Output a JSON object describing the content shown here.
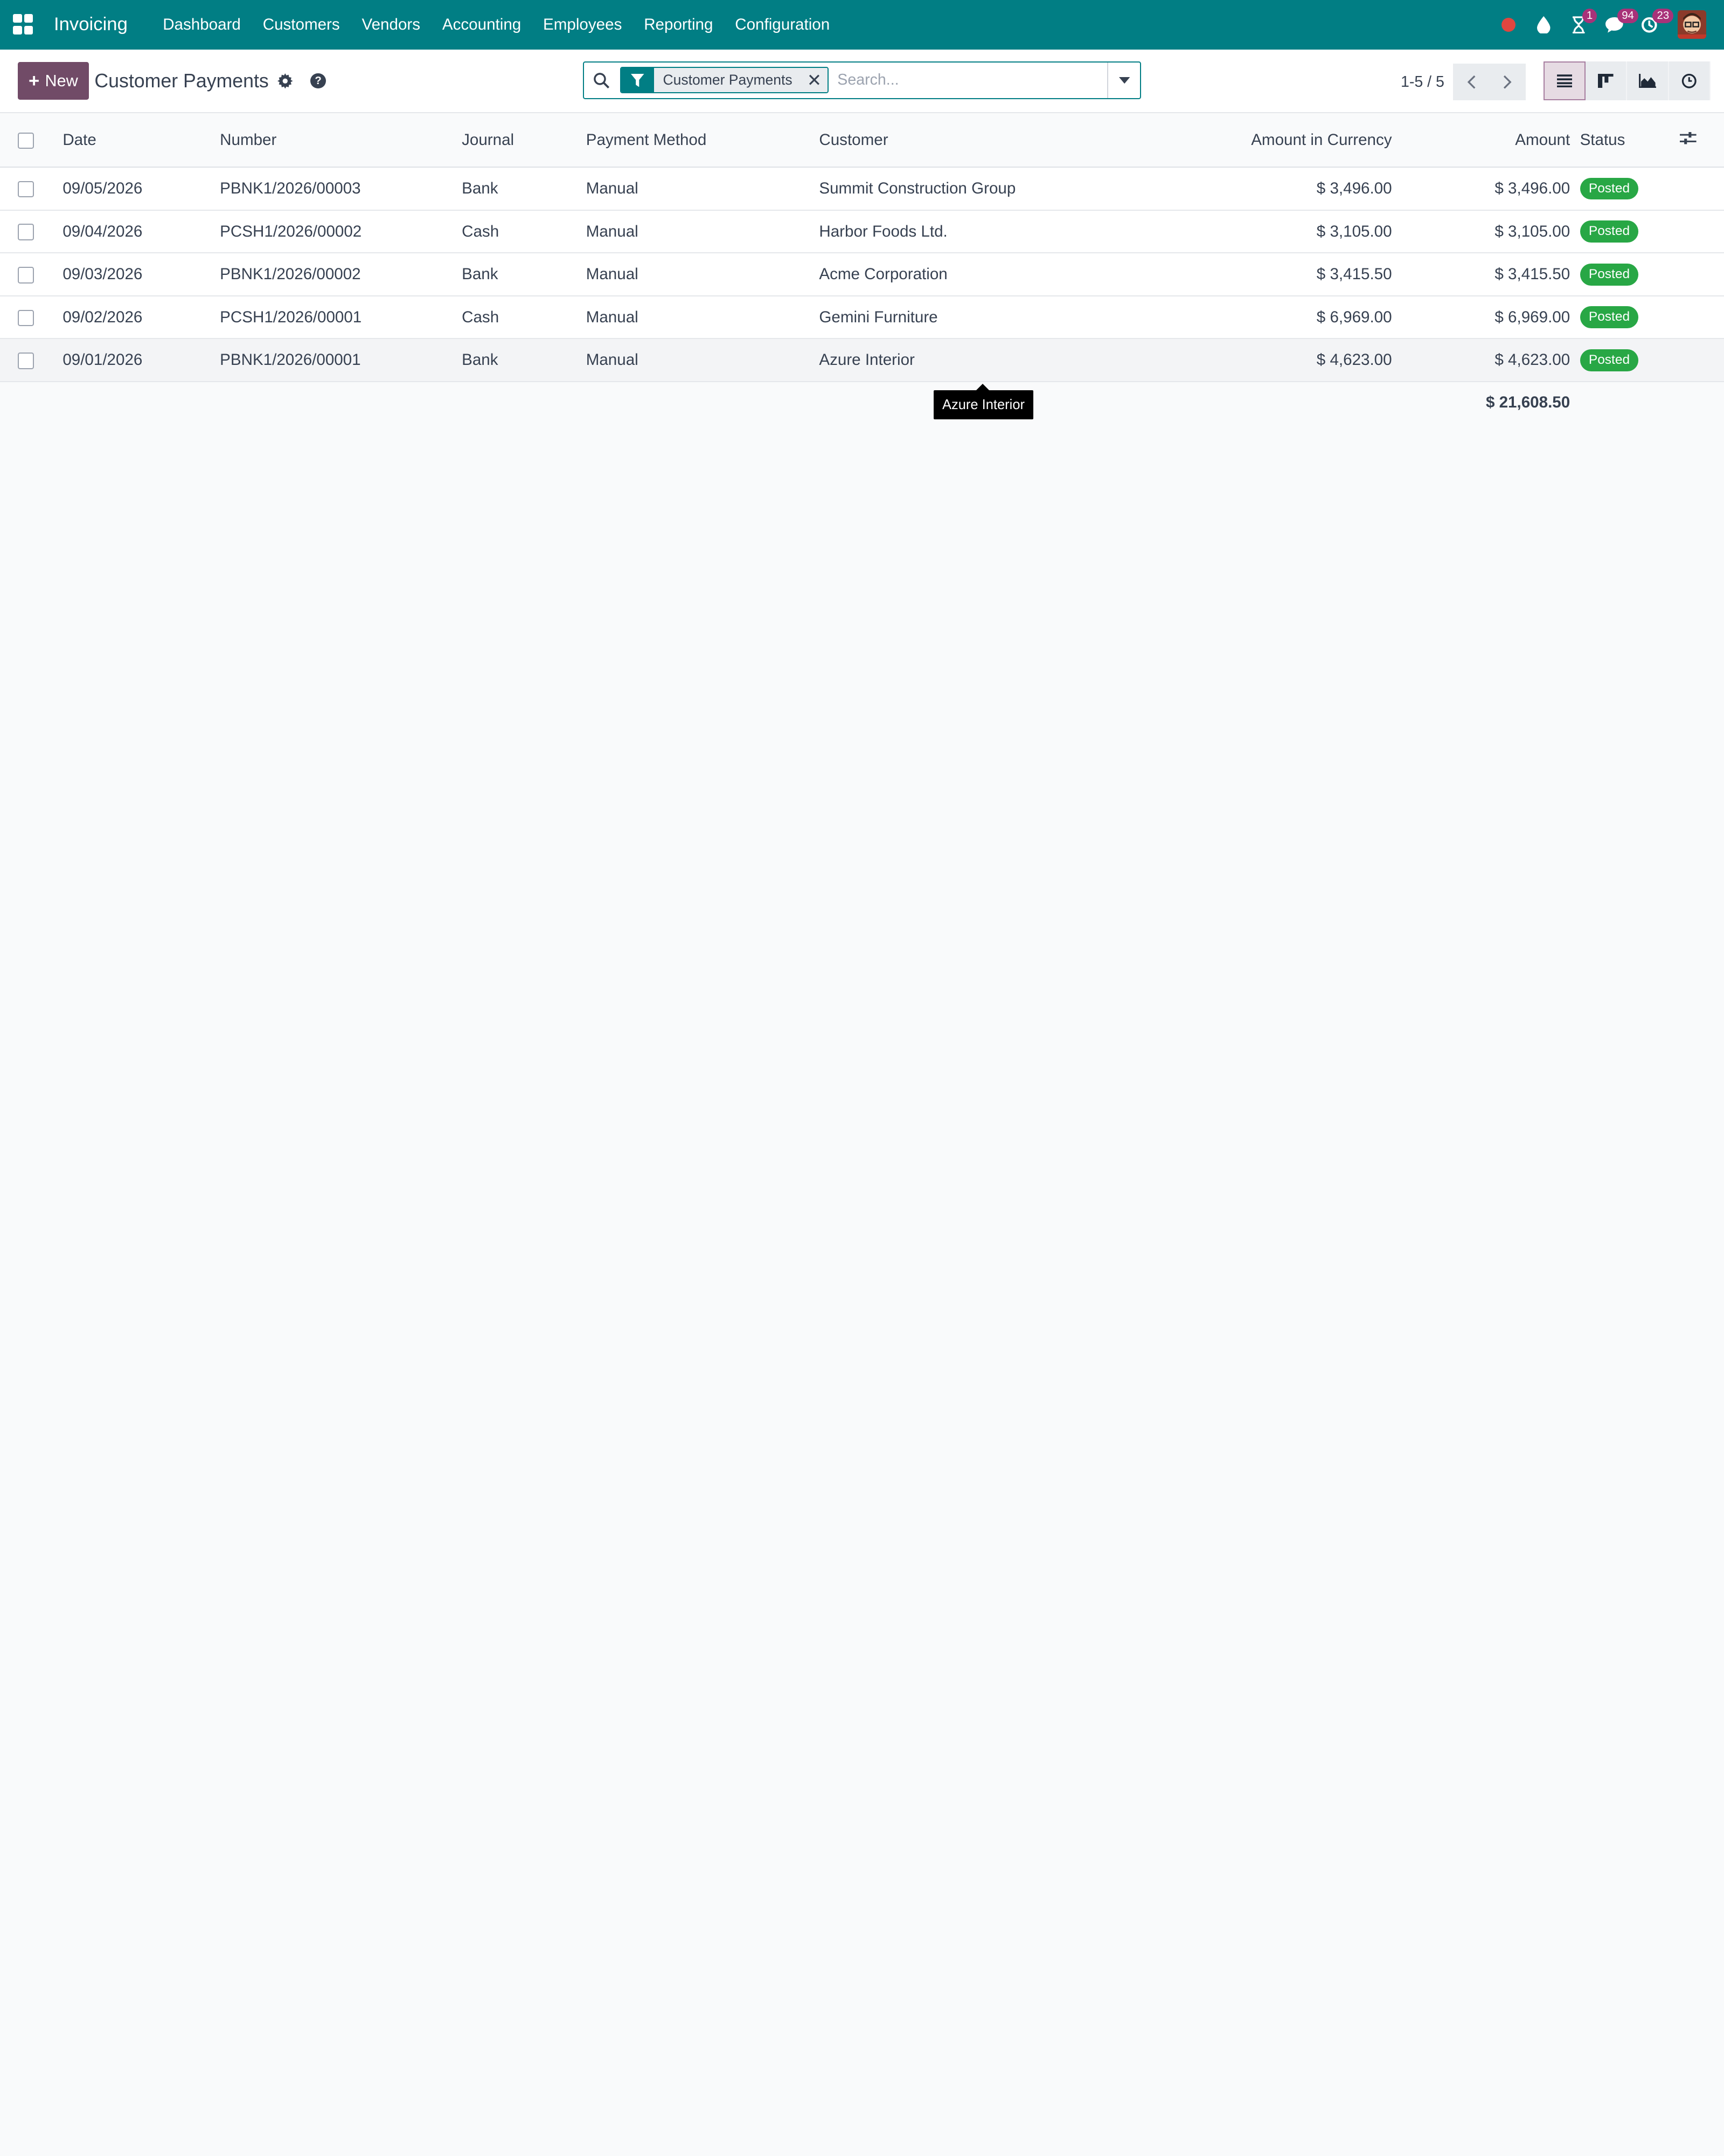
{
  "navbar": {
    "brand": "Invoicing",
    "menu": [
      "Dashboard",
      "Customers",
      "Vendors",
      "Accounting",
      "Employees",
      "Reporting",
      "Configuration"
    ],
    "badges": {
      "activities": "1",
      "messages": "94",
      "updates": "23"
    }
  },
  "control": {
    "new_label": "New",
    "title": "Customer Payments",
    "search_facet": "Customer Payments",
    "search_placeholder": "Search...",
    "pager": "1-5 / 5"
  },
  "table": {
    "columns": {
      "date": "Date",
      "number": "Number",
      "journal": "Journal",
      "payment_method": "Payment Method",
      "customer": "Customer",
      "amount_currency": "Amount in Currency",
      "amount": "Amount",
      "status": "Status"
    },
    "rows": [
      {
        "date": "09/05/2026",
        "number": "PBNK1/2026/00003",
        "journal": "Bank",
        "method": "Manual",
        "customer": "Summit Construction Group",
        "amount_currency": "$ 3,496.00",
        "amount": "$ 3,496.00",
        "status": "Posted"
      },
      {
        "date": "09/04/2026",
        "number": "PCSH1/2026/00002",
        "journal": "Cash",
        "method": "Manual",
        "customer": "Harbor Foods Ltd.",
        "amount_currency": "$ 3,105.00",
        "amount": "$ 3,105.00",
        "status": "Posted"
      },
      {
        "date": "09/03/2026",
        "number": "PBNK1/2026/00002",
        "journal": "Bank",
        "method": "Manual",
        "customer": "Acme Corporation",
        "amount_currency": "$ 3,415.50",
        "amount": "$ 3,415.50",
        "status": "Posted"
      },
      {
        "date": "09/02/2026",
        "number": "PCSH1/2026/00001",
        "journal": "Cash",
        "method": "Manual",
        "customer": "Gemini Furniture",
        "amount_currency": "$ 6,969.00",
        "amount": "$ 6,969.00",
        "status": "Posted"
      },
      {
        "date": "09/01/2026",
        "number": "PBNK1/2026/00001",
        "journal": "Bank",
        "method": "Manual",
        "customer": "Azure Interior",
        "amount_currency": "$ 4,623.00",
        "amount": "$ 4,623.00",
        "status": "Posted"
      }
    ],
    "total_amount": "$ 21,608.50"
  },
  "tooltip": "Azure Interior",
  "colors": {
    "navbar": "#017e84",
    "primary": "#714b67",
    "status_posted": "#28a745",
    "badge": "#a83279"
  }
}
